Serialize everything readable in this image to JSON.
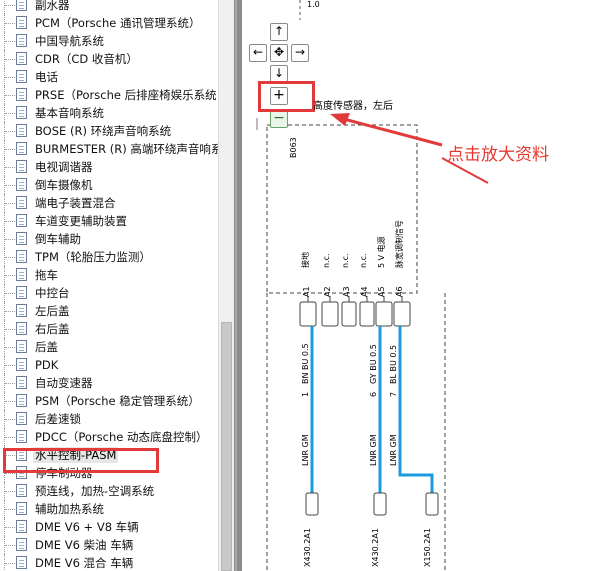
{
  "tree": {
    "items": [
      {
        "label": "副水器"
      },
      {
        "label": "PCM（Porsche 通讯管理系统）"
      },
      {
        "label": "中国导航系统"
      },
      {
        "label": "CDR（CD 收音机）"
      },
      {
        "label": "电话"
      },
      {
        "label": "PRSE（Porsche 后排座椅娱乐系统"
      },
      {
        "label": "基本音响系统"
      },
      {
        "label": "BOSE (R) 环绕声音响系统"
      },
      {
        "label": "BURMESTER (R) 高端环绕声音响系"
      },
      {
        "label": "电视调谐器"
      },
      {
        "label": "倒车摄像机"
      },
      {
        "label": "端电子装置混合"
      },
      {
        "label": "车道变更辅助装置"
      },
      {
        "label": "倒车辅助"
      },
      {
        "label": "TPM（轮胎压力监测）"
      },
      {
        "label": "拖车"
      },
      {
        "label": "中控台"
      },
      {
        "label": "左后盖"
      },
      {
        "label": "右后盖"
      },
      {
        "label": "后盖"
      },
      {
        "label": "PDK"
      },
      {
        "label": "自动变速器"
      },
      {
        "label": "PSM（Porsche 稳定管理系统）"
      },
      {
        "label": "后差速锁"
      },
      {
        "label": "PDCC（Porsche 动态底盘控制）"
      },
      {
        "label": "水平控制-PASM"
      },
      {
        "label": "停车制动器"
      },
      {
        "label": "预连线，加热-空调系统"
      },
      {
        "label": "辅助加热系统"
      },
      {
        "label": "DME V6 + V8 车辆"
      },
      {
        "label": "DME V6 柴油 车辆"
      },
      {
        "label": "DME V6 混合 车辆"
      }
    ],
    "selected_index": 25
  },
  "diagram": {
    "nav": {
      "up": "↑",
      "left": "←",
      "center": "✥",
      "right": "→",
      "down": "↓",
      "zoom_in": "+",
      "zoom_out": "−"
    },
    "top_label": "1.0",
    "component_title": "高度传感器，左后",
    "component_id": "B063",
    "pin_functions": [
      "接地",
      "n.c.",
      "n.c.",
      "n.c.",
      "5 V 电源",
      "脉宽调制信号"
    ],
    "pins": [
      "A1",
      "A2",
      "A3",
      "A4",
      "A5",
      "A6"
    ],
    "wires": [
      {
        "code1": "1",
        "code2": "BN BU 0.5",
        "code3": "LNR GM",
        "connector": "X430.2A1"
      },
      {
        "code1": "6",
        "code2": "GY BU 0.5",
        "code3": "LNR GM",
        "connector": "X430.2A1"
      },
      {
        "code1": "7",
        "code2": "BL BU 0.5",
        "code3": "LNR GM",
        "connector": "X150.2A1"
      }
    ],
    "wire_color": "#1a9be0",
    "annotation": "点击放大资料",
    "annotation_color": "#e8382f"
  }
}
